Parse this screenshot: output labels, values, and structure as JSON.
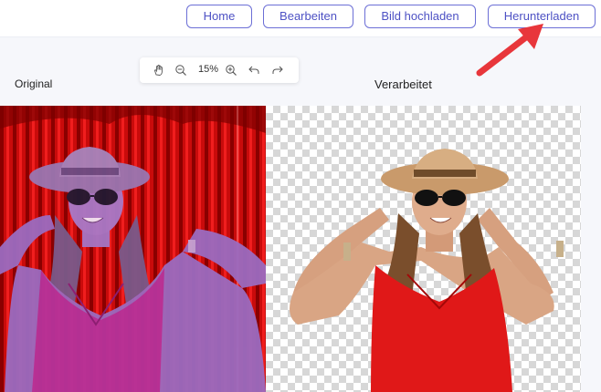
{
  "header": {
    "buttons": [
      {
        "label": "Home"
      },
      {
        "label": "Bearbeiten"
      },
      {
        "label": "Bild hochladen"
      },
      {
        "label": "Herunterladen"
      }
    ]
  },
  "toolbar": {
    "zoom": "15%",
    "tools": [
      "hand-icon",
      "zoom-out-icon",
      "zoom-in-icon",
      "undo-icon",
      "redo-icon"
    ]
  },
  "panels": {
    "original_label": "Original",
    "processed_label": "Verarbeitet"
  },
  "colors": {
    "accent": "#4d51c4",
    "annotation_arrow": "#e8363b",
    "curtain_red": "#d80c0c",
    "dress_red": "#e01818"
  }
}
